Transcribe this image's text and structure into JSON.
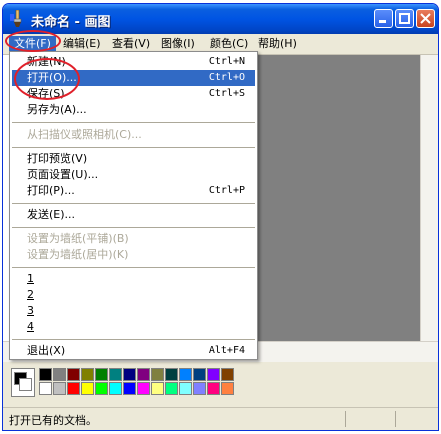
{
  "window": {
    "title": "未命名 - 画图"
  },
  "menubar": [
    {
      "label": "文件(F)"
    },
    {
      "label": "编辑(E)"
    },
    {
      "label": "查看(V)"
    },
    {
      "label": "图像(I)"
    },
    {
      "label": "颜色(C)"
    },
    {
      "label": "帮助(H)"
    }
  ],
  "file_menu": {
    "items": [
      {
        "label": "新建(N)",
        "shortcut": "Ctrl+N"
      },
      {
        "label": "打开(O)...",
        "shortcut": "Ctrl+O"
      },
      {
        "label": "保存(S)",
        "shortcut": "Ctrl+S"
      },
      {
        "label": "另存为(A)...",
        "shortcut": ""
      },
      {
        "label": "从扫描仪或照相机(C)...",
        "shortcut": ""
      },
      {
        "label": "打印预览(V)",
        "shortcut": ""
      },
      {
        "label": "页面设置(U)...",
        "shortcut": ""
      },
      {
        "label": "打印(P)...",
        "shortcut": "Ctrl+P"
      },
      {
        "label": "发送(E)...",
        "shortcut": ""
      },
      {
        "label": "设置为墙纸(平铺)(B)",
        "shortcut": ""
      },
      {
        "label": "设置为墙纸(居中)(K)",
        "shortcut": ""
      },
      {
        "label": "1",
        "shortcut": ""
      },
      {
        "label": "2",
        "shortcut": ""
      },
      {
        "label": "3",
        "shortcut": ""
      },
      {
        "label": "4",
        "shortcut": ""
      },
      {
        "label": "退出(X)",
        "shortcut": "Alt+F4"
      }
    ]
  },
  "status": {
    "text": "打开已有的文档。"
  },
  "colors": {
    "palette": [
      "#000000",
      "#808080",
      "#800000",
      "#808000",
      "#008000",
      "#008080",
      "#000080",
      "#800080",
      "#808040",
      "#004040",
      "#0080ff",
      "#004080",
      "#8000ff",
      "#804000",
      "#ffffff",
      "#c0c0c0",
      "#ff0000",
      "#ffff00",
      "#00ff00",
      "#00ffff",
      "#0000ff",
      "#ff00ff",
      "#ffff80",
      "#00ff80",
      "#80ffff",
      "#8080ff",
      "#ff0080",
      "#ff8040"
    ],
    "selection": "#316ac5",
    "annotation": "#e0202a"
  }
}
